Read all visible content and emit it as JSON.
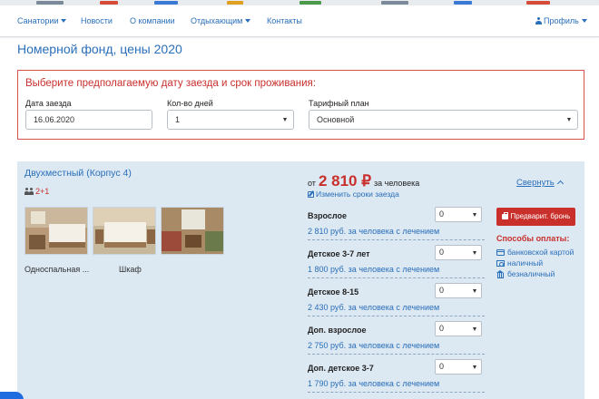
{
  "nav": {
    "items": [
      {
        "label": "Санатории",
        "dropdown": true
      },
      {
        "label": "Новости",
        "dropdown": false
      },
      {
        "label": "О компании",
        "dropdown": false
      },
      {
        "label": "Отдыхающим",
        "dropdown": true
      },
      {
        "label": "Контакты",
        "dropdown": false
      }
    ],
    "profile_label": "Профиль"
  },
  "page": {
    "title": "Номерной фонд, цены 2020"
  },
  "date_picker": {
    "heading": "Выберите предполагаемую дату заезда и срок проживания:",
    "arrival": {
      "label": "Дата заезда",
      "value": "16.06.2020"
    },
    "days": {
      "label": "Кол-во дней",
      "value": "1"
    },
    "tariff": {
      "label": "Тарифный план",
      "value": "Основной"
    }
  },
  "room": {
    "title": "Двухместный (Корпус 4)",
    "capacity": "2+1",
    "photos": [
      {
        "caption": "Односпальная ..."
      },
      {
        "caption": "Шкаф"
      },
      {
        "caption": ""
      }
    ],
    "price_prefix": "от",
    "price": "2 810 ₽",
    "price_suffix": "за человека",
    "change_dates": "Изменить сроки заезда",
    "collapse_label": "Свернуть",
    "guests": [
      {
        "label": "Взрослое",
        "count": "0",
        "price": "2 810 руб. за человека с лечением"
      },
      {
        "label": "Детское 3-7 лет",
        "count": "0",
        "price": "1 800 руб. за человека с лечением"
      },
      {
        "label": "Детское 8-15",
        "count": "0",
        "price": "2 430 руб. за человека с лечением"
      },
      {
        "label": "Доп. взрослое",
        "count": "0",
        "price": "2 750 руб. за человека с лечением"
      },
      {
        "label": "Доп. детское 3-7",
        "count": "0",
        "price": "1 790 руб. за человека с лечением"
      }
    ],
    "book_button": "Предварит. бронь",
    "payment": {
      "title": "Способы оплаты:",
      "methods": [
        "банковской картой",
        "наличный",
        "безналичный"
      ]
    }
  },
  "colors": {
    "accent": "#2a6fba",
    "danger": "#c9302c",
    "room_bg": "#dce8f2"
  }
}
